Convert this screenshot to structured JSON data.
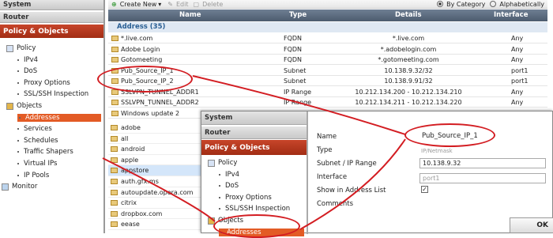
{
  "sidebar": {
    "system": "System",
    "router": "Router",
    "policy_objects": "Policy & Objects",
    "tree": [
      {
        "label": "Policy",
        "level": 1,
        "icon": "policy-icon"
      },
      {
        "label": "IPv4",
        "level": 2
      },
      {
        "label": "DoS",
        "level": 2
      },
      {
        "label": "Proxy Options",
        "level": 2
      },
      {
        "label": "SSL/SSH Inspection",
        "level": 2
      },
      {
        "label": "Objects",
        "level": 1,
        "icon": "objects-icon"
      },
      {
        "label": "Addresses",
        "level": 2,
        "selected": true
      },
      {
        "label": "Services",
        "level": 2
      },
      {
        "label": "Schedules",
        "level": 2
      },
      {
        "label": "Traffic Shapers",
        "level": 2
      },
      {
        "label": "Virtual IPs",
        "level": 2
      },
      {
        "label": "IP Pools",
        "level": 2
      },
      {
        "label": "Monitor",
        "level": 0,
        "icon": "monitor-icon"
      }
    ]
  },
  "toolbar": {
    "create_new": "Create New",
    "edit": "Edit",
    "delete": "Delete",
    "by_category": "By Category",
    "alphabetically": "Alphabetically"
  },
  "table": {
    "columns": [
      "Name",
      "Type",
      "Details",
      "Interface"
    ],
    "group": "Address (35)",
    "rows": [
      {
        "name": "*.live.com",
        "type": "FQDN",
        "details": "*.live.com",
        "interface": "Any"
      },
      {
        "name": "Adobe Login",
        "type": "FQDN",
        "details": "*.adobelogin.com",
        "interface": "Any"
      },
      {
        "name": "Gotomeeting",
        "type": "FQDN",
        "details": "*.gotomeeting.com",
        "interface": "Any"
      },
      {
        "name": "Pub_Source_IP_1",
        "type": "Subnet",
        "details": "10.138.9.32/32",
        "interface": "port1"
      },
      {
        "name": "Pub_Source_IP_2",
        "type": "Subnet",
        "details": "10.138.9.91/32",
        "interface": "port1"
      },
      {
        "name": "SSLVPN_TUNNEL_ADDR1",
        "type": "IP Range",
        "details": "10.212.134.200 - 10.212.134.210",
        "interface": "Any"
      },
      {
        "name": "SSLVPN_TUNNEL_ADDR2",
        "type": "IP Range",
        "details": "10.212.134.211 - 10.212.134.220",
        "interface": "Any"
      },
      {
        "name": "Windows update 2",
        "type": "",
        "details": "",
        "interface": ""
      }
    ],
    "extra_names": [
      "adobe",
      "all",
      "android",
      "apple",
      "appstore",
      "auth.gfx.ms",
      "autoupdate.opera.com",
      "citrix",
      "dropbox.com",
      "eease"
    ]
  },
  "overlay": {
    "system": "System",
    "router": "Router",
    "policy_objects": "Policy & Objects",
    "tree": [
      {
        "label": "Policy",
        "level": 1,
        "icon": "policy-icon"
      },
      {
        "label": "IPv4",
        "level": 2
      },
      {
        "label": "DoS",
        "level": 2
      },
      {
        "label": "Proxy Options",
        "level": 2
      },
      {
        "label": "SSL/SSH Inspection",
        "level": 2
      },
      {
        "label": "Objects",
        "level": 1,
        "icon": "objects-icon"
      },
      {
        "label": "Addresses",
        "level": 2,
        "selected": true
      }
    ]
  },
  "form": {
    "name_label": "Name",
    "name_value": "Pub_Source_IP_1",
    "type_label": "Type",
    "type_value": "IP/Netmask",
    "subnet_label": "Subnet / IP Range",
    "subnet_value": "10.138.9.32",
    "interface_label": "Interface",
    "interface_value": "port1",
    "show_label": "Show in Address List",
    "comments_label": "Comments",
    "ok": "OK"
  },
  "colors": {
    "accent": "#a22d14",
    "header": "#4c5b6e",
    "group": "#2a5f94",
    "highlight": "#d31d22"
  }
}
